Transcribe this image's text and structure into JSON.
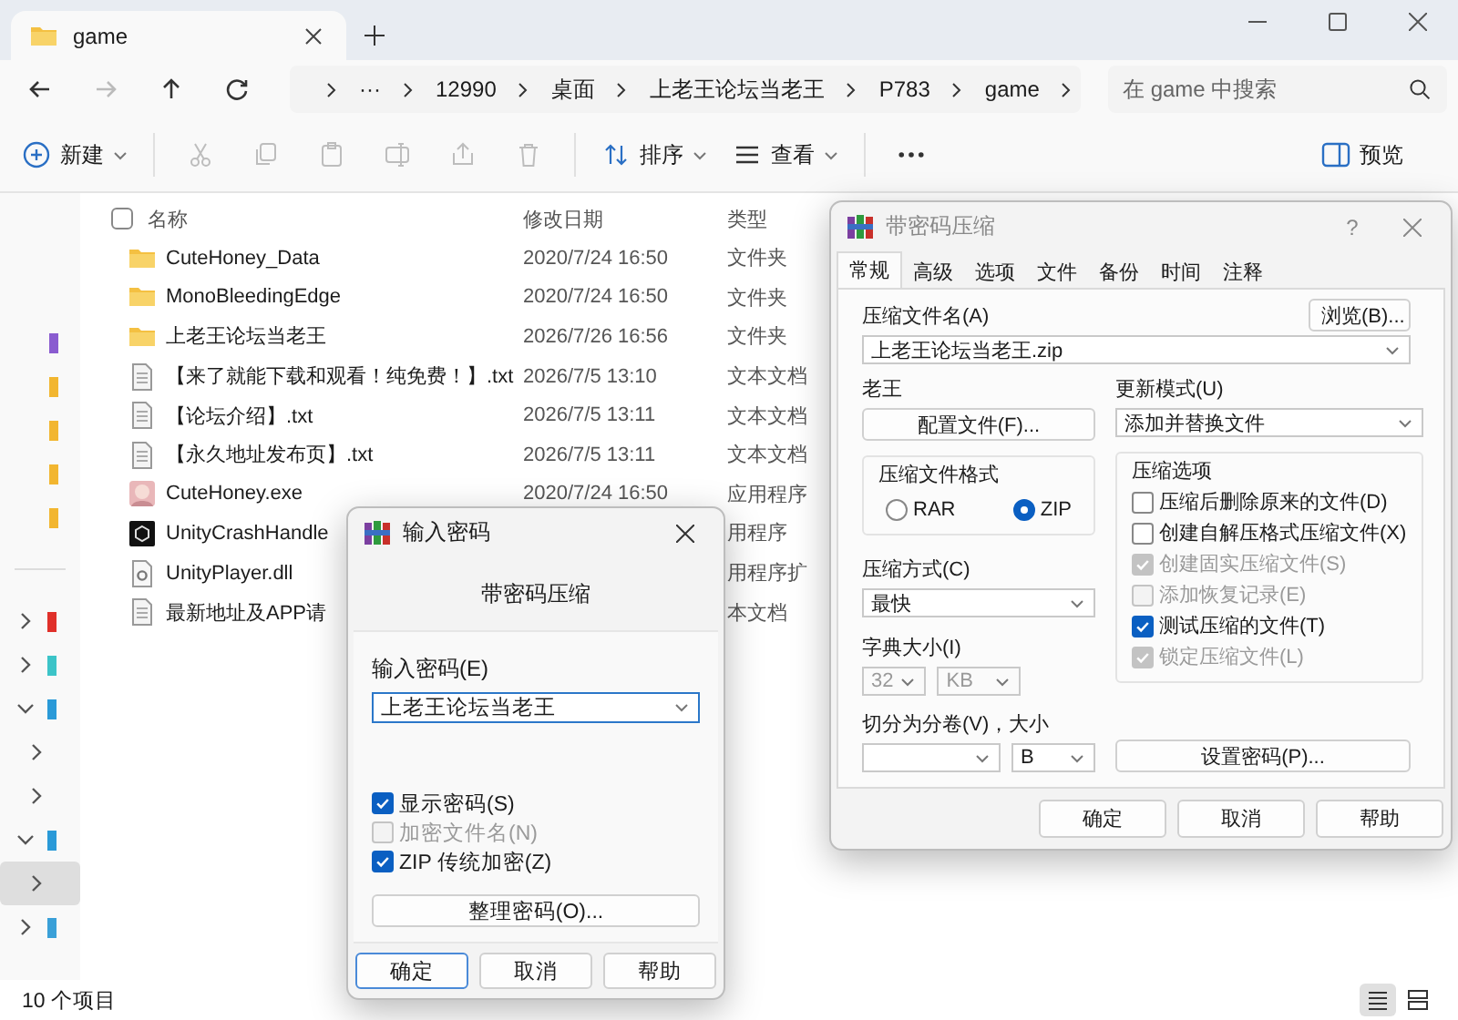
{
  "explorer": {
    "tab": {
      "title": "game"
    },
    "nav_buttons": [
      {
        "kind": "back",
        "disabled": false
      },
      {
        "kind": "forward",
        "disabled": true
      },
      {
        "kind": "up",
        "disabled": false
      },
      {
        "kind": "refresh",
        "disabled": false
      }
    ],
    "breadcrumb": [
      "···",
      "12990",
      "桌面",
      "上老王论坛当老王",
      "P783",
      "game"
    ],
    "search": {
      "placeholder": "在 game 中搜索"
    },
    "toolbar": [
      {
        "kind": "new",
        "label": "新建",
        "disabled": false
      },
      {
        "kind": "cut",
        "disabled": true
      },
      {
        "kind": "copy",
        "disabled": true
      },
      {
        "kind": "paste",
        "disabled": true
      },
      {
        "kind": "rename",
        "disabled": true
      },
      {
        "kind": "share",
        "disabled": true
      },
      {
        "kind": "delete",
        "disabled": true
      },
      {
        "kind": "sort",
        "label": "排序",
        "disabled": false
      },
      {
        "kind": "view",
        "label": "查看",
        "disabled": false
      },
      {
        "kind": "more",
        "disabled": false
      }
    ],
    "preview": {
      "label": "预览"
    },
    "sidebar": [
      {
        "kind": "pinned",
        "color": "#8a5cd0",
        "selected": false
      },
      {
        "kind": "pinned",
        "color": "#f2b630",
        "selected": false
      },
      {
        "kind": "pinned",
        "color": "#f2b630",
        "selected": false
      },
      {
        "kind": "pinned",
        "color": "#f2b630",
        "selected": false
      },
      {
        "kind": "pinned",
        "color": "#f2b630",
        "selected": false
      },
      {
        "kind": "node",
        "color": "#e0302a",
        "expanded": false,
        "selected": false
      },
      {
        "kind": "node",
        "color": "#3cc4c8",
        "expanded": false,
        "selected": false
      },
      {
        "kind": "node",
        "color": "#2a9ad8",
        "expanded": true,
        "selected": false,
        "children": [
          {
            "kind": "node",
            "expanded": false,
            "selected": false
          },
          {
            "kind": "node",
            "expanded": false,
            "selected": false
          }
        ]
      },
      {
        "kind": "node",
        "color": "#2a9ad8",
        "expanded": true,
        "selected": false,
        "children": [
          {
            "kind": "node",
            "expanded": false,
            "selected": true
          }
        ]
      },
      {
        "kind": "node",
        "color": "#3aa0d8",
        "expanded": false,
        "selected": false
      }
    ],
    "select_all": {
      "checked": false
    },
    "columns": [
      "名称",
      "修改日期",
      "类型"
    ],
    "files": [
      {
        "kind": "folder",
        "name": "CuteHoney_Data",
        "date": "2020/7/24 16:50",
        "type": "文件夹"
      },
      {
        "kind": "folder",
        "name": "MonoBleedingEdge",
        "date": "2020/7/24 16:50",
        "type": "文件夹"
      },
      {
        "kind": "folder",
        "name": "上老王论坛当老王",
        "date": "2026/7/26 16:56",
        "type": "文件夹"
      },
      {
        "kind": "text",
        "name": "【来了就能下载和观看！纯免费！】.txt",
        "date": "2026/7/5 13:10",
        "type": "文本文档"
      },
      {
        "kind": "text",
        "name": "【论坛介绍】.txt",
        "date": "2026/7/5 13:11",
        "type": "文本文档"
      },
      {
        "kind": "text",
        "name": "【永久地址发布页】.txt",
        "date": "2026/7/5 13:11",
        "type": "文本文档"
      },
      {
        "kind": "app",
        "name": "CuteHoney.exe",
        "date": "2020/7/24 16:50",
        "type": "应用程序"
      },
      {
        "kind": "unity",
        "name": "UnityCrashHandle",
        "type": "用程序"
      },
      {
        "kind": "dll",
        "name": "UnityPlayer.dll",
        "type": "用程序扩"
      },
      {
        "kind": "text",
        "name": "最新地址及APP请",
        "type": "本文档"
      }
    ],
    "status": "10 个项目",
    "view_modes": [
      {
        "kind": "details",
        "selected": true
      },
      {
        "kind": "tiles",
        "selected": false
      }
    ]
  },
  "password_dialog": {
    "title": "输入密码",
    "heading": "带密码压缩",
    "field_label": "输入密码(E)",
    "value": "上老王论坛当老王",
    "options": [
      {
        "label": "显示密码(S)",
        "checked": true,
        "disabled": false
      },
      {
        "label": "加密文件名(N)",
        "checked": false,
        "disabled": true
      },
      {
        "label": "ZIP 传统加密(Z)",
        "checked": true,
        "disabled": false
      }
    ],
    "organize_button": "整理密码(O)...",
    "buttons": [
      {
        "label": "确定",
        "default": true
      },
      {
        "label": "取消",
        "default": false
      },
      {
        "label": "帮助",
        "default": false
      }
    ]
  },
  "archive_dialog": {
    "title": "带密码压缩",
    "active": false,
    "help_button": "?",
    "tabs": [
      {
        "label": "常规",
        "selected": true
      },
      {
        "label": "高级",
        "selected": false
      },
      {
        "label": "选项",
        "selected": false
      },
      {
        "label": "文件",
        "selected": false
      },
      {
        "label": "备份",
        "selected": false
      },
      {
        "label": "时间",
        "selected": false
      },
      {
        "label": "注释",
        "selected": false
      }
    ],
    "archive_name_label": "压缩文件名(A)",
    "browse_button": "浏览(B)...",
    "archive_name": "上老王论坛当老王.zip",
    "profile_label": "老王",
    "profile_button": "配置文件(F)...",
    "update_label": "更新模式(U)",
    "update_mode": "添加并替换文件",
    "format_label": "压缩文件格式",
    "formats": [
      {
        "label": "RAR",
        "selected": false
      },
      {
        "label": "ZIP",
        "selected": true
      }
    ],
    "method_label": "压缩方式(C)",
    "method": "最快",
    "dict_label": "字典大小(I)",
    "dict_size": "32",
    "dict_unit": "KB",
    "dict_disabled": true,
    "split_label": "切分为分卷(V)，大小",
    "split_unit": "B",
    "options_label": "压缩选项",
    "options": [
      {
        "label": "压缩后删除原来的文件(D)",
        "checked": false,
        "disabled": false
      },
      {
        "label": "创建自解压格式压缩文件(X)",
        "checked": false,
        "disabled": false
      },
      {
        "label": "创建固实压缩文件(S)",
        "checked": true,
        "disabled": true
      },
      {
        "label": "添加恢复记录(E)",
        "checked": false,
        "disabled": true
      },
      {
        "label": "测试压缩的文件(T)",
        "checked": true,
        "disabled": false
      },
      {
        "label": "锁定压缩文件(L)",
        "checked": true,
        "disabled": true
      }
    ],
    "password_button": "设置密码(P)...",
    "buttons": [
      {
        "label": "确定",
        "default": false
      },
      {
        "label": "取消",
        "default": false
      },
      {
        "label": "帮助",
        "default": false
      }
    ]
  }
}
